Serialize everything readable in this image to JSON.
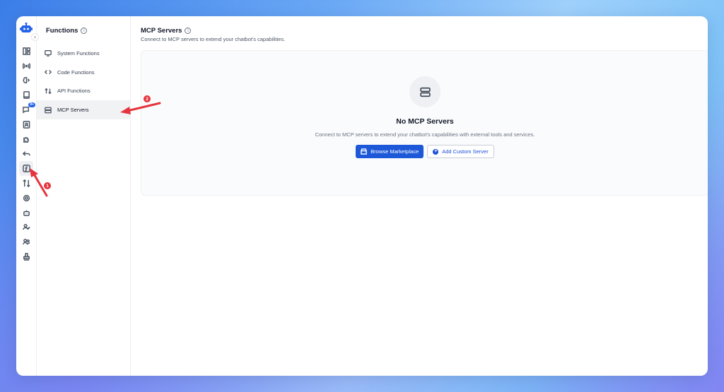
{
  "sidebar": {
    "title": "Functions",
    "items": [
      {
        "label": "System Functions",
        "icon": "monitor-icon"
      },
      {
        "label": "Code Functions",
        "icon": "code-icon"
      },
      {
        "label": "API Functions",
        "icon": "arrows-updown-icon"
      },
      {
        "label": "MCP Servers",
        "icon": "server-icon"
      }
    ]
  },
  "rail": {
    "badge": "9+"
  },
  "main": {
    "title": "MCP Servers",
    "subtitle": "Connect to MCP servers to extend your chatbot's capabilities.",
    "empty_title": "No MCP Servers",
    "empty_desc": "Connect to MCP servers to extend your chatbot's capabilities with external tools and services.",
    "browse_label": "Browse Marketplace",
    "add_label": "Add Custom Server"
  },
  "annotations": {
    "marker1": "1",
    "marker2": "2"
  },
  "colors": {
    "primary": "#1d58d8",
    "marker": "#e5343d"
  }
}
